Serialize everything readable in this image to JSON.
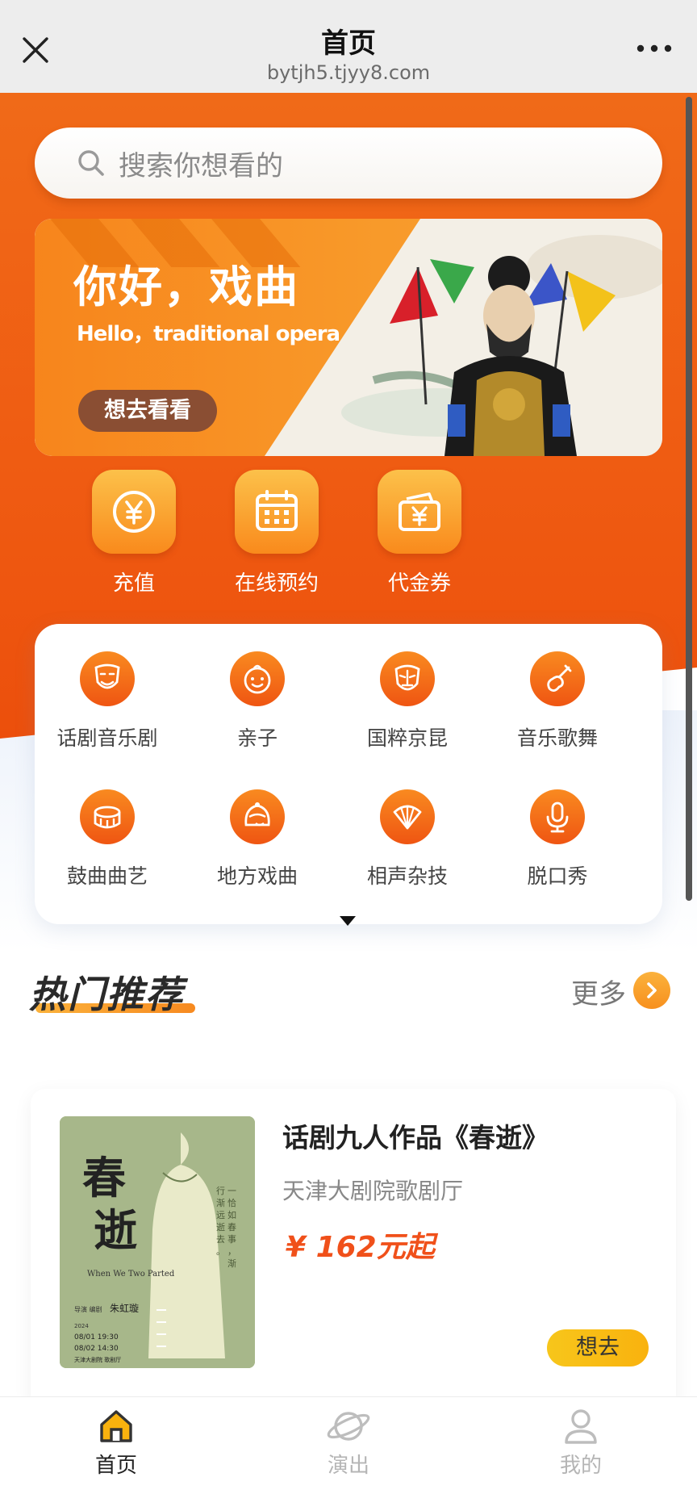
{
  "titlebar": {
    "title": "首页",
    "url": "bytjh5.tjyy8.com",
    "close_icon": "close-icon",
    "more_icon": "more-dots-icon"
  },
  "search": {
    "placeholder": "搜索你想看的",
    "icon": "search-icon"
  },
  "banner": {
    "title": "你好，戏曲",
    "subtitle": "Hello，traditional opera",
    "button": "想去看看"
  },
  "quick_actions": [
    {
      "label": "充值",
      "icon": "yen-coin-icon"
    },
    {
      "label": "在线预约",
      "icon": "calendar-icon"
    },
    {
      "label": "代金券",
      "icon": "voucher-wallet-icon"
    }
  ],
  "categories": [
    {
      "label": "话剧音乐剧",
      "icon": "drama-masks-icon"
    },
    {
      "label": "亲子",
      "icon": "child-face-icon"
    },
    {
      "label": "国粹京昆",
      "icon": "opera-mask-icon"
    },
    {
      "label": "音乐歌舞",
      "icon": "violin-icon"
    },
    {
      "label": "鼓曲曲艺",
      "icon": "drum-icon"
    },
    {
      "label": "地方戏曲",
      "icon": "helmet-icon"
    },
    {
      "label": "相声杂技",
      "icon": "fan-icon"
    },
    {
      "label": "脱口秀",
      "icon": "microphone-icon"
    }
  ],
  "hot": {
    "title": "热门推荐",
    "more": "更多"
  },
  "recommendation": {
    "name": "话剧九人作品《春逝》",
    "venue": "天津大剧院歌剧厅",
    "price": "¥ 162元起",
    "button": "想去",
    "poster": {
      "title": "春逝",
      "title_en": "When We Two Parted",
      "vertical_text": "一恰如春事，渐行渐远逝去。",
      "credit_label": "导演 编剧",
      "credit_name": "朱虹璇",
      "dates": [
        "08/01 19:30",
        "08/02 14:30"
      ],
      "venue": "天津大剧院 歌剧厅",
      "year": "2024"
    }
  },
  "tabbar": [
    {
      "label": "首页",
      "icon": "home-icon",
      "active": true
    },
    {
      "label": "演出",
      "icon": "planet-icon",
      "active": false
    },
    {
      "label": "我的",
      "icon": "user-icon",
      "active": false
    }
  ],
  "colors": {
    "hero_orange": "#ef5b12",
    "accent_yellow": "#f9b20e",
    "price_red": "#f0501a"
  }
}
